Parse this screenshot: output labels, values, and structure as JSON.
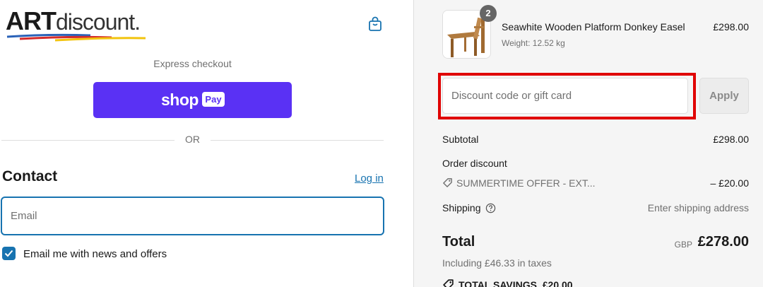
{
  "brand": {
    "logo_bold": "ART",
    "logo_light": "discount",
    "logo_mark": "."
  },
  "header": {
    "cart_icon": "shopping-bag-icon"
  },
  "express": {
    "label": "Express checkout",
    "shop_pay_word": "shop",
    "shop_pay_badge": "Pay",
    "divider": "OR"
  },
  "contact": {
    "title": "Contact",
    "login_link": "Log in",
    "email_placeholder": "Email",
    "email_value": "",
    "newsletter_label": "Email me with news and offers",
    "newsletter_checked": true
  },
  "order": {
    "item": {
      "quantity_badge": "2",
      "name": "Seawhite Wooden Platform Donkey Easel",
      "weight": "Weight: 12.52 kg",
      "price": "£298.00"
    },
    "discount_placeholder": "Discount code or gift card",
    "apply_label": "Apply",
    "subtotal_label": "Subtotal",
    "subtotal_value": "£298.00",
    "order_discount_label": "Order discount",
    "discount_code": "SUMMERTIME OFFER - EXT...",
    "discount_value": "– £20.00",
    "shipping_label": "Shipping",
    "shipping_value": "Enter shipping address",
    "total_label": "Total",
    "total_currency": "GBP",
    "total_value": "£278.00",
    "tax_note": "Including £46.33 in taxes",
    "savings_label": "TOTAL SAVINGS",
    "savings_value": "£20.00"
  },
  "colors": {
    "accent": "#1773b0",
    "shop_pay": "#5a31f4",
    "highlight": "#e00000"
  }
}
